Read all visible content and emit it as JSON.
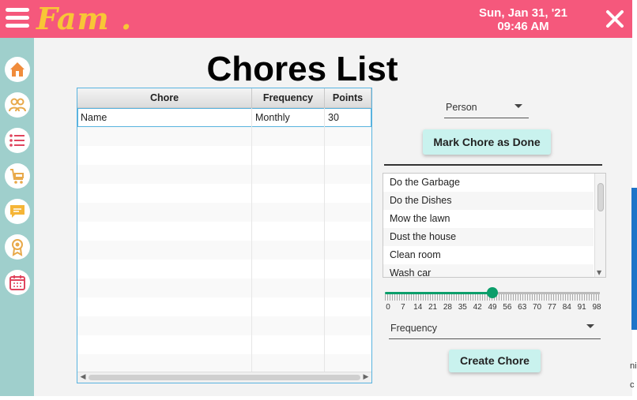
{
  "app": {
    "logo": "Fam .",
    "accent": "#f5587c",
    "sidebar_color": "#9fcfcc",
    "logo_color": "#f8c636"
  },
  "header": {
    "date": "Sun, Jan 31, '21",
    "time": "09:46 AM",
    "close_icon": "close-icon",
    "menu_icon": "hamburger-menu-icon"
  },
  "sidebar": {
    "items": [
      {
        "icon": "home-icon"
      },
      {
        "icon": "family-icon"
      },
      {
        "icon": "checklist-icon"
      },
      {
        "icon": "shopping-cart-icon"
      },
      {
        "icon": "chat-icon"
      },
      {
        "icon": "award-icon"
      },
      {
        "icon": "calendar-icon"
      }
    ]
  },
  "page": {
    "title": "Chores List"
  },
  "table": {
    "columns": [
      "Chore",
      "Frequency",
      "Points"
    ],
    "rows": [
      [
        "Name",
        "Monthly",
        "30"
      ]
    ]
  },
  "right": {
    "person_select": "Person",
    "mark_done_button": "Mark Chore as Done",
    "chores": [
      "Do the Garbage",
      "Do the Dishes",
      "Mow the lawn",
      "Dust the house",
      "Clean room",
      "Wash car"
    ],
    "slider": {
      "min": 0,
      "max": 98,
      "value": 49,
      "ticks": [
        "0",
        "7",
        "14",
        "21",
        "28",
        "35",
        "42",
        "49",
        "56",
        "63",
        "70",
        "77",
        "84",
        "91",
        "98"
      ]
    },
    "frequency_select": "Frequency",
    "create_button": "Create Chore"
  },
  "edge_fragments": [
    "ni",
    "c"
  ]
}
